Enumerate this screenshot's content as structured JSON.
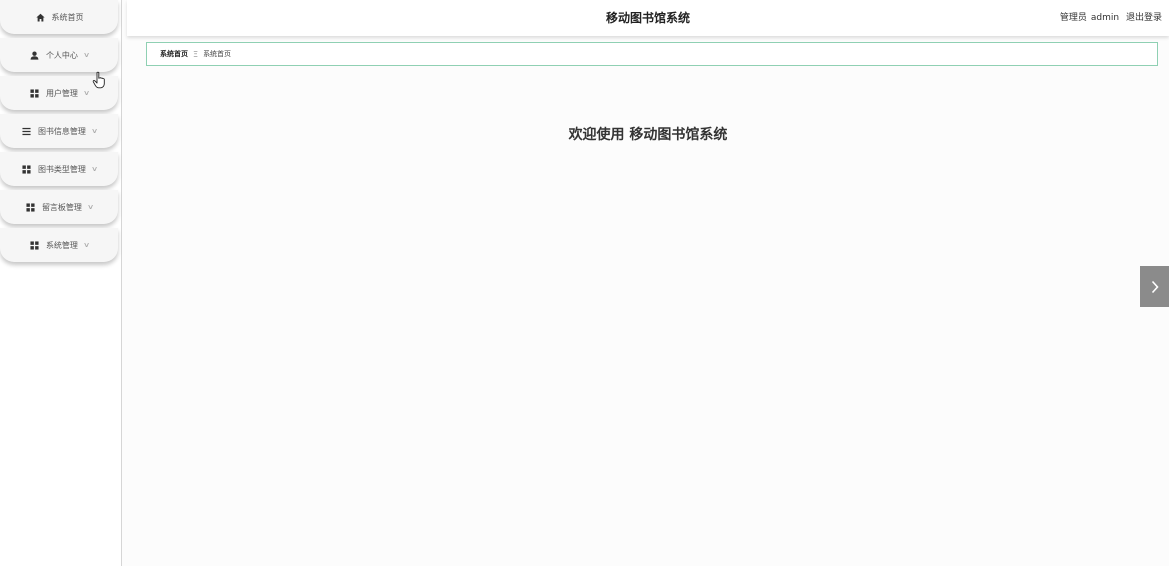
{
  "app": {
    "title": "移动图书馆系统",
    "welcome": "欢迎使用 移动图书馆系统"
  },
  "header": {
    "role": "管理员",
    "username": "admin",
    "logout": "退出登录"
  },
  "breadcrumb": {
    "home": "系统首页",
    "separator": "Ξ",
    "current": "系统首页"
  },
  "sidebar": {
    "items": [
      {
        "label": "系统首页",
        "icon": "home-icon",
        "has_submenu": false
      },
      {
        "label": "个人中心",
        "icon": "user-icon",
        "has_submenu": true
      },
      {
        "label": "用户管理",
        "icon": "grid-icon",
        "has_submenu": true
      },
      {
        "label": "图书信息管理",
        "icon": "list-icon",
        "has_submenu": true
      },
      {
        "label": "图书类型管理",
        "icon": "grid-icon",
        "has_submenu": true
      },
      {
        "label": "留言板管理",
        "icon": "grid-icon",
        "has_submenu": true
      },
      {
        "label": "系统管理",
        "icon": "grid-icon",
        "has_submenu": true
      }
    ],
    "chevron": "∨"
  },
  "colors": {
    "breadcrumb_border": "#8fd0b3",
    "arrow_bg": "#8b8b8b",
    "sidebar_item_bg": "#f6f6f6"
  }
}
